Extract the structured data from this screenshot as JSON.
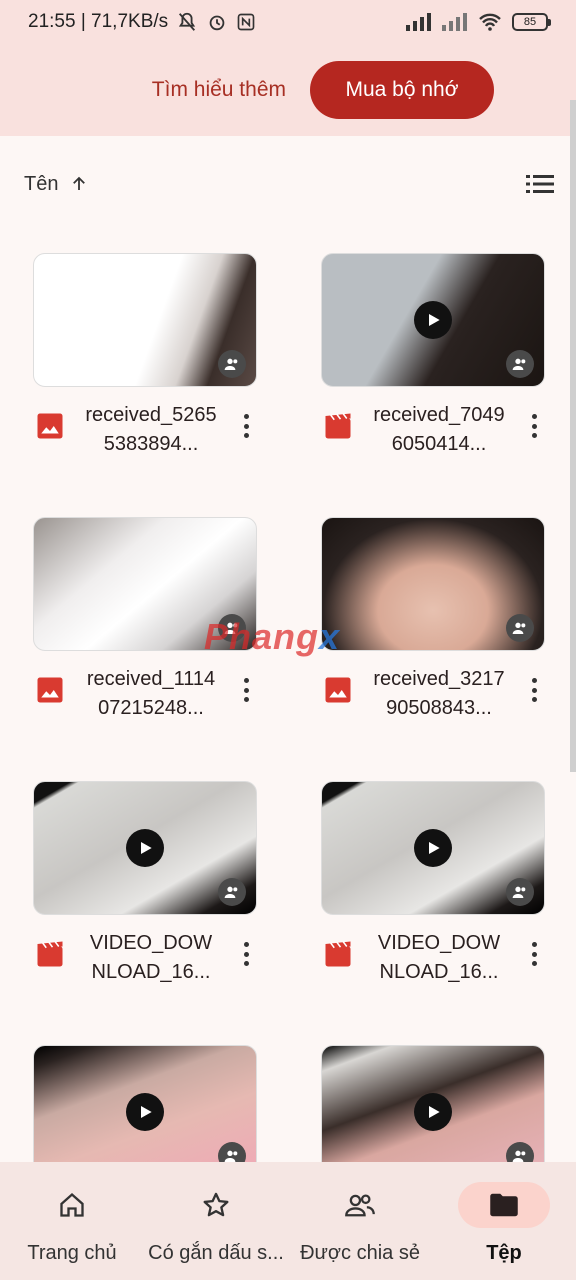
{
  "status_bar": {
    "time_speed": "21:55 | 71,7KB/s",
    "battery": "85"
  },
  "banner": {
    "learn_more": "Tìm hiểu thêm",
    "buy_storage": "Mua bộ nhớ"
  },
  "sort": {
    "label": "Tên",
    "direction_icon": "arrow-up-icon",
    "view_icon": "list-view-icon"
  },
  "files": [
    {
      "name": "received_52655383894...",
      "type": "image",
      "is_video": false
    },
    {
      "name": "received_70496050414...",
      "type": "video",
      "is_video": true
    },
    {
      "name": "received_111407215248...",
      "type": "image",
      "is_video": false
    },
    {
      "name": "received_321790508843...",
      "type": "image",
      "is_video": false
    },
    {
      "name": "VIDEO_DOWNLOAD_16...",
      "type": "video",
      "is_video": true
    },
    {
      "name": "VIDEO_DOWNLOAD_16...",
      "type": "video",
      "is_video": true
    },
    {
      "name": "",
      "type": "video",
      "is_video": true
    },
    {
      "name": "",
      "type": "video",
      "is_video": true
    }
  ],
  "watermark": {
    "text_main": "Phang",
    "text_accent": "x"
  },
  "bottom_nav": [
    {
      "label": "Trang chủ",
      "icon": "home-icon",
      "active": false
    },
    {
      "label": "Có gắn dấu s...",
      "icon": "star-icon",
      "active": false
    },
    {
      "label": "Được chia sẻ",
      "icon": "people-icon",
      "active": false
    },
    {
      "label": "Tệp",
      "icon": "folder-icon",
      "active": true
    }
  ],
  "colors": {
    "accent": "#b52720",
    "banner_bg": "#f9e1de",
    "page_bg": "#fdf7f5",
    "image_icon": "#d93a30",
    "video_icon": "#d93a30"
  }
}
